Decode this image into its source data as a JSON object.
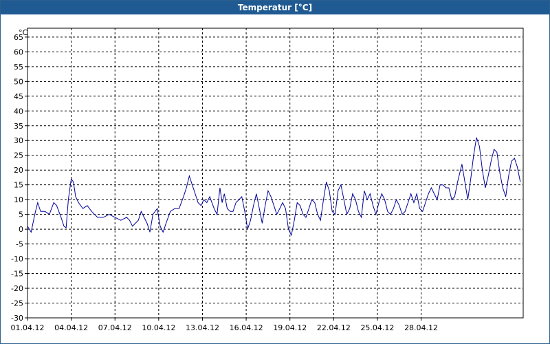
{
  "window": {
    "title": "Temperatur [°C]"
  },
  "chart_data": {
    "type": "line",
    "title": "Temperatur [°C]",
    "ylabel": "°C",
    "xlabel": "",
    "ylim": [
      -30,
      68
    ],
    "grid": true,
    "x_tick_labels": [
      "01.04.12",
      "04.04.12",
      "07.04.12",
      "10.04.12",
      "13.04.12",
      "16.04.12",
      "19.04.12",
      "22.04.12",
      "25.04.12",
      "28.04.12"
    ],
    "y_ticks": [
      65,
      60,
      55,
      50,
      45,
      40,
      35,
      30,
      25,
      20,
      15,
      10,
      5,
      0,
      -5,
      -10,
      -15,
      -20,
      -25,
      -30
    ],
    "line_color": "#00009c",
    "x_unit": "days since 01.04.12",
    "series": [
      {
        "name": "Temperatur",
        "points": [
          [
            0.0,
            1
          ],
          [
            0.25,
            -1
          ],
          [
            0.5,
            5
          ],
          [
            0.7,
            9
          ],
          [
            0.9,
            6
          ],
          [
            1.2,
            6
          ],
          [
            1.5,
            5
          ],
          [
            1.8,
            9
          ],
          [
            2.0,
            8
          ],
          [
            2.3,
            4
          ],
          [
            2.5,
            1
          ],
          [
            2.65,
            0.5
          ],
          [
            2.8,
            10
          ],
          [
            3.0,
            17
          ],
          [
            3.15,
            16
          ],
          [
            3.3,
            11
          ],
          [
            3.5,
            9
          ],
          [
            3.8,
            7
          ],
          [
            4.1,
            8
          ],
          [
            4.4,
            6
          ],
          [
            4.8,
            4
          ],
          [
            5.2,
            4
          ],
          [
            5.6,
            5
          ],
          [
            6.0,
            4
          ],
          [
            6.4,
            3
          ],
          [
            6.8,
            4
          ],
          [
            7.0,
            3
          ],
          [
            7.2,
            1
          ],
          [
            7.4,
            2
          ],
          [
            7.6,
            3
          ],
          [
            7.8,
            6
          ],
          [
            8.0,
            4
          ],
          [
            8.2,
            2
          ],
          [
            8.4,
            -1
          ],
          [
            8.6,
            5
          ],
          [
            8.9,
            7
          ],
          [
            9.1,
            1
          ],
          [
            9.3,
            -1
          ],
          [
            9.5,
            2
          ],
          [
            9.8,
            6
          ],
          [
            10.1,
            7
          ],
          [
            10.4,
            7
          ],
          [
            10.7,
            11
          ],
          [
            10.9,
            14
          ],
          [
            11.1,
            18
          ],
          [
            11.3,
            15
          ],
          [
            11.5,
            12
          ],
          [
            11.7,
            9
          ],
          [
            11.9,
            8
          ],
          [
            12.1,
            10
          ],
          [
            12.3,
            9
          ],
          [
            12.5,
            11
          ],
          [
            12.8,
            7
          ],
          [
            13.0,
            5
          ],
          [
            13.2,
            14
          ],
          [
            13.35,
            9
          ],
          [
            13.5,
            12
          ],
          [
            13.7,
            7
          ],
          [
            13.9,
            6
          ],
          [
            14.1,
            6
          ],
          [
            14.3,
            9
          ],
          [
            14.5,
            10
          ],
          [
            14.7,
            11
          ],
          [
            14.9,
            6
          ],
          [
            15.1,
            0
          ],
          [
            15.3,
            3
          ],
          [
            15.5,
            8
          ],
          [
            15.7,
            12
          ],
          [
            15.9,
            7
          ],
          [
            16.1,
            2
          ],
          [
            16.3,
            8
          ],
          [
            16.5,
            13
          ],
          [
            16.7,
            11
          ],
          [
            16.9,
            8
          ],
          [
            17.1,
            5
          ],
          [
            17.3,
            7
          ],
          [
            17.5,
            9
          ],
          [
            17.7,
            7
          ],
          [
            17.9,
            0
          ],
          [
            18.1,
            -2
          ],
          [
            18.3,
            3
          ],
          [
            18.5,
            9
          ],
          [
            18.7,
            8
          ],
          [
            18.9,
            5
          ],
          [
            19.1,
            4
          ],
          [
            19.3,
            7
          ],
          [
            19.5,
            10
          ],
          [
            19.7,
            9
          ],
          [
            19.9,
            5
          ],
          [
            20.1,
            3
          ],
          [
            20.3,
            10
          ],
          [
            20.5,
            16
          ],
          [
            20.7,
            13
          ],
          [
            20.9,
            6
          ],
          [
            21.1,
            5
          ],
          [
            21.3,
            13
          ],
          [
            21.5,
            15
          ],
          [
            21.7,
            10
          ],
          [
            21.9,
            5
          ],
          [
            22.1,
            7
          ],
          [
            22.3,
            12
          ],
          [
            22.5,
            10
          ],
          [
            22.7,
            6
          ],
          [
            22.9,
            4
          ],
          [
            23.1,
            13
          ],
          [
            23.3,
            10
          ],
          [
            23.5,
            12
          ],
          [
            23.7,
            8
          ],
          [
            23.9,
            5
          ],
          [
            24.1,
            9
          ],
          [
            24.3,
            12
          ],
          [
            24.5,
            10
          ],
          [
            24.7,
            6
          ],
          [
            24.9,
            5
          ],
          [
            25.1,
            7
          ],
          [
            25.3,
            10
          ],
          [
            25.5,
            8
          ],
          [
            25.7,
            5
          ],
          [
            25.9,
            6
          ],
          [
            26.1,
            9
          ],
          [
            26.3,
            12
          ],
          [
            26.5,
            9
          ],
          [
            26.7,
            12
          ],
          [
            26.9,
            7
          ],
          [
            27.1,
            6
          ],
          [
            27.3,
            9
          ],
          [
            27.5,
            12
          ],
          [
            27.7,
            14
          ],
          [
            27.9,
            12
          ],
          [
            28.1,
            10
          ],
          [
            28.3,
            15
          ],
          [
            28.5,
            15
          ],
          [
            28.7,
            14
          ],
          [
            28.9,
            14
          ],
          [
            29.1,
            10
          ],
          [
            29.3,
            11
          ],
          [
            29.5,
            16
          ],
          [
            29.8,
            22
          ],
          [
            30.0,
            16
          ],
          [
            30.2,
            10
          ],
          [
            30.4,
            17
          ],
          [
            30.6,
            25
          ],
          [
            30.8,
            31
          ],
          [
            31.0,
            28
          ],
          [
            31.2,
            20
          ],
          [
            31.4,
            14
          ],
          [
            31.6,
            18
          ],
          [
            31.8,
            23
          ],
          [
            32.0,
            27
          ],
          [
            32.2,
            26
          ],
          [
            32.4,
            19
          ],
          [
            32.6,
            14
          ],
          [
            32.8,
            11
          ],
          [
            33.0,
            18
          ],
          [
            33.2,
            23
          ],
          [
            33.4,
            24
          ],
          [
            33.6,
            21
          ],
          [
            33.8,
            16
          ]
        ]
      }
    ]
  }
}
